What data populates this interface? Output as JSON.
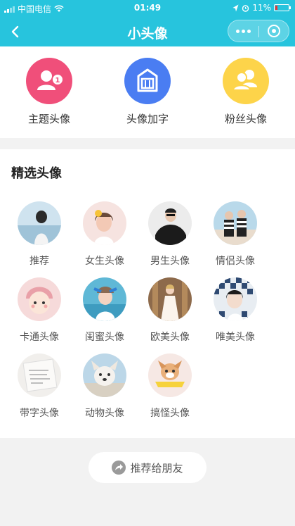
{
  "status_bar": {
    "carrier": "中国电信",
    "time": "01:49",
    "battery": "11%",
    "icons": [
      "signal-icon",
      "wifi-icon",
      "location-icon",
      "alarm-icon",
      "battery-icon"
    ]
  },
  "nav": {
    "title": "小头像",
    "back_icon": "chevron-left-icon",
    "more_icon": "more-dots-icon",
    "close_icon": "mini-program-close-icon",
    "color": "#27c4dd"
  },
  "categories": [
    {
      "label": "主题头像",
      "icon": "user-badge-icon",
      "color": "#f04f7a",
      "badge": "1"
    },
    {
      "label": "头像加字",
      "icon": "frame-text-icon",
      "color": "#4a7df2"
    },
    {
      "label": "粉丝头像",
      "icon": "users-icon",
      "color": "#fdd44a"
    }
  ],
  "featured": {
    "title": "精选头像",
    "items": [
      {
        "label": "推荐"
      },
      {
        "label": "女生头像"
      },
      {
        "label": "男生头像"
      },
      {
        "label": "情侣头像"
      },
      {
        "label": "卡通头像"
      },
      {
        "label": "闺蜜头像"
      },
      {
        "label": "欧美头像"
      },
      {
        "label": "唯美头像"
      },
      {
        "label": "带字头像"
      },
      {
        "label": "动物头像"
      },
      {
        "label": "搞怪头像"
      }
    ]
  },
  "share": {
    "label": "推荐给朋友",
    "icon": "share-icon"
  }
}
